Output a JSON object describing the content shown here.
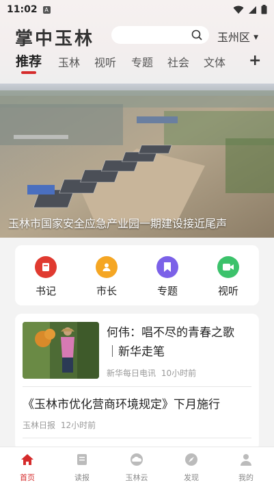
{
  "status_bar": {
    "time": "11:02",
    "sim_glyph": "A"
  },
  "header": {
    "app_title": "掌中玉林",
    "search_placeholder": "",
    "region": "玉州区"
  },
  "tabs": [
    {
      "label": "推荐",
      "active": true
    },
    {
      "label": "玉林"
    },
    {
      "label": "视听"
    },
    {
      "label": "专题"
    },
    {
      "label": "社会"
    },
    {
      "label": "文体"
    }
  ],
  "banner": {
    "caption": "玉林市国家安全应急产业园一期建设接近尾声"
  },
  "quick_links": [
    {
      "label": "书记",
      "color": "#e03a30",
      "icon": "notebook-icon"
    },
    {
      "label": "市长",
      "color": "#f5a623",
      "icon": "person-icon"
    },
    {
      "label": "专题",
      "color": "#7b61e8",
      "icon": "bookmark-icon"
    },
    {
      "label": "视听",
      "color": "#3cc26b",
      "icon": "video-icon"
    }
  ],
  "articles": [
    {
      "title_line1": "何伟：唱不尽的青春之歌",
      "title_line2": "｜新华走笔",
      "source": "新华每日电讯",
      "time": "10小时前"
    },
    {
      "title": "《玉林市优化营商环境规定》下月施行",
      "source": "玉林日报",
      "time": "12小时前"
    }
  ],
  "bottom_nav": [
    {
      "label": "首页",
      "icon": "home-icon",
      "active": true
    },
    {
      "label": "读报",
      "icon": "newspaper-icon"
    },
    {
      "label": "玉林云",
      "icon": "cloud-icon"
    },
    {
      "label": "发现",
      "icon": "compass-icon"
    },
    {
      "label": "我的",
      "icon": "user-icon"
    }
  ],
  "colors": {
    "accent": "#d52b2b",
    "inactive": "#888888"
  }
}
